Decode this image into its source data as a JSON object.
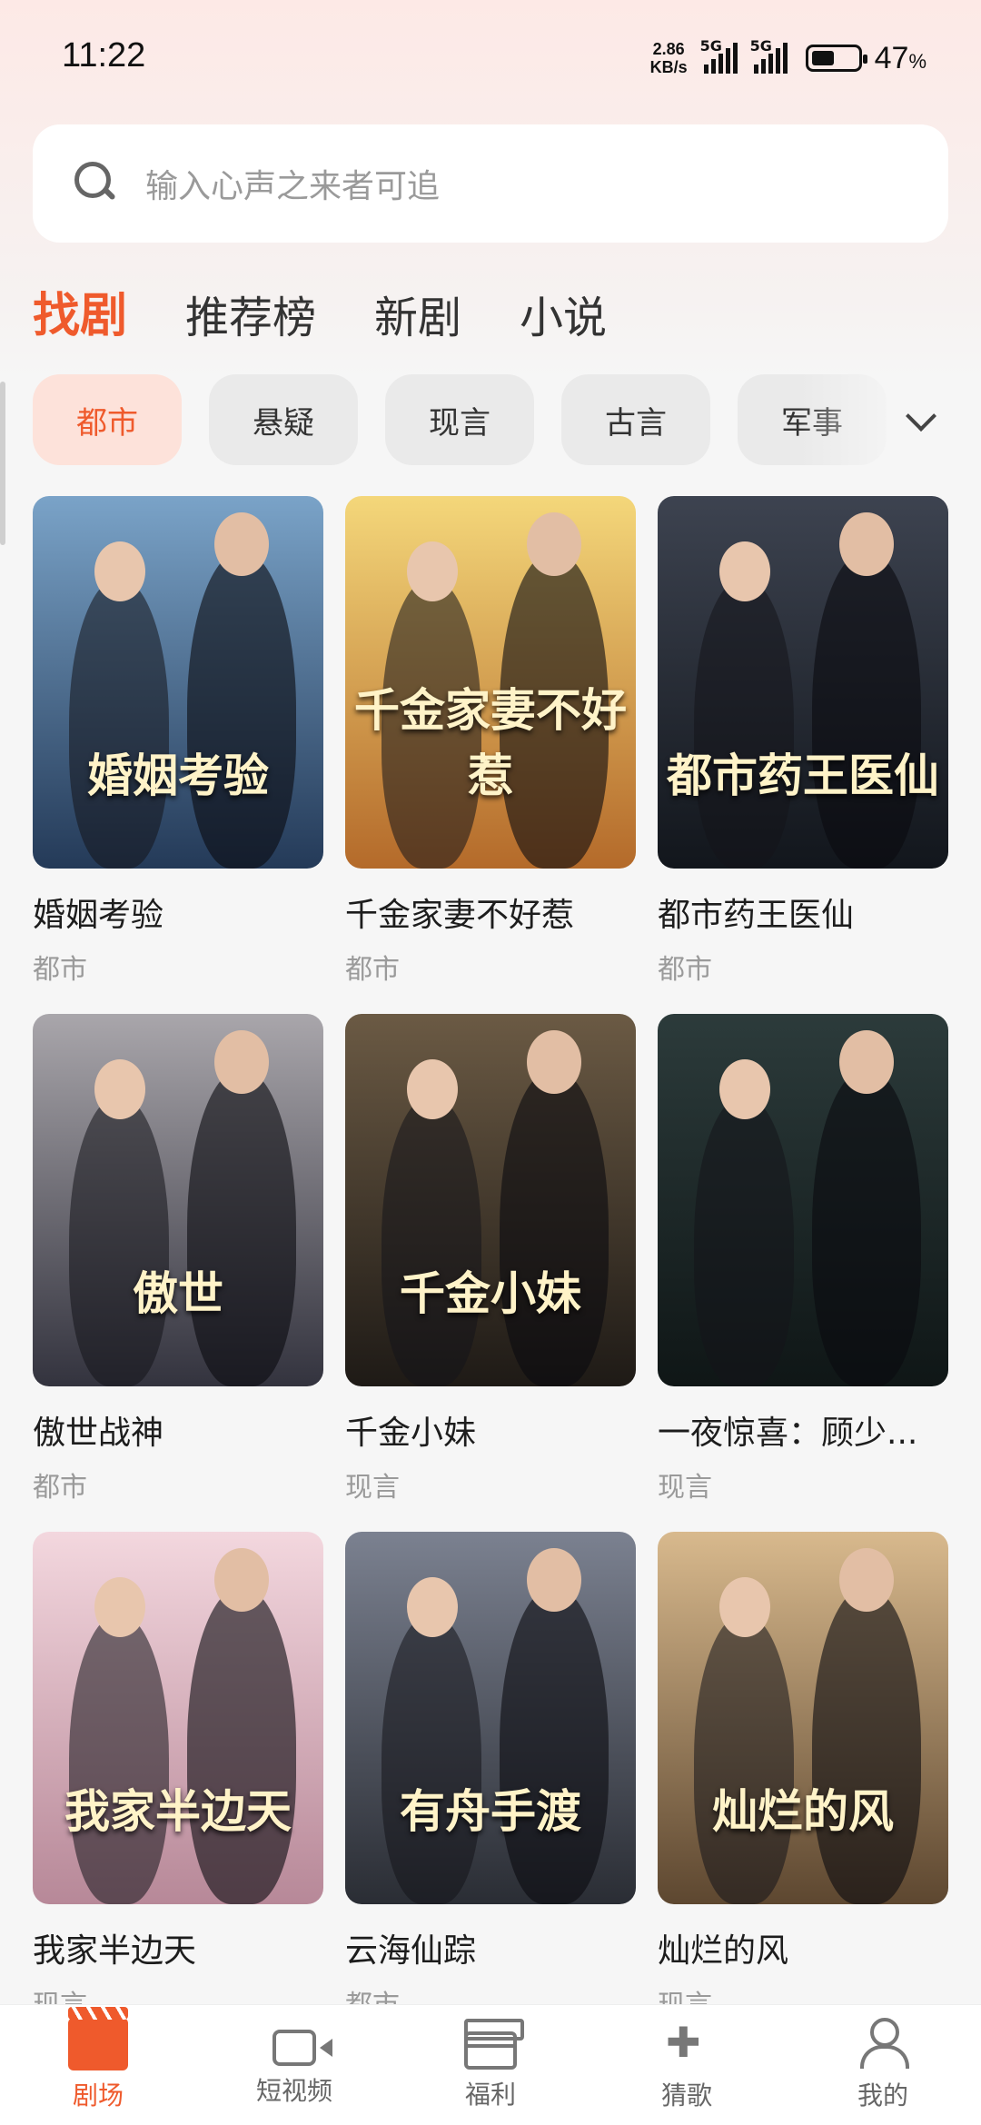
{
  "status": {
    "time": "11:22",
    "net_speed_value": "2.86",
    "net_speed_unit": "KB/s",
    "sig1": "5G",
    "sig2": "5G",
    "battery_percent": "47",
    "battery_unit": "%"
  },
  "search": {
    "placeholder": "输入心声之来者可追"
  },
  "top_tabs": [
    "找剧",
    "推荐榜",
    "新剧",
    "小说"
  ],
  "chips": [
    "都市",
    "悬疑",
    "现言",
    "古言",
    "军事"
  ],
  "items": [
    {
      "title": "婚姻考验",
      "tag": "都市",
      "poster_text": "婚姻考验",
      "colors": [
        "#7aa3c8",
        "#243a58"
      ]
    },
    {
      "title": "千金家妻不好惹",
      "tag": "都市",
      "poster_text": "千金家妻不好惹",
      "colors": [
        "#f4d77a",
        "#b46a2a"
      ]
    },
    {
      "title": "都市药王医仙",
      "tag": "都市",
      "poster_text": "都市药王医仙",
      "colors": [
        "#3d4350",
        "#12161c"
      ]
    },
    {
      "title": "傲世战神",
      "tag": "都市",
      "poster_text": "傲世",
      "colors": [
        "#a9a6ab",
        "#33333e"
      ]
    },
    {
      "title": "千金小妹",
      "tag": "现言",
      "poster_text": "千金小妹",
      "colors": [
        "#6b5a44",
        "#1e1a16"
      ]
    },
    {
      "title": "一夜惊喜：顾少...",
      "tag": "现言",
      "poster_text": "",
      "colors": [
        "#2c3b3b",
        "#0f1616"
      ]
    },
    {
      "title": "我家半边天",
      "tag": "现言",
      "poster_text": "我家半边天",
      "colors": [
        "#f3d7de",
        "#b78898"
      ]
    },
    {
      "title": "云海仙踪",
      "tag": "都市",
      "poster_text": "有舟手渡",
      "colors": [
        "#7b8190",
        "#2a2d34"
      ]
    },
    {
      "title": "灿烂的风",
      "tag": "现言",
      "poster_text": "灿烂的风",
      "colors": [
        "#d8b98d",
        "#5d4730"
      ]
    }
  ],
  "nav": [
    {
      "label": "剧场",
      "icon": "clapper-icon",
      "active": true
    },
    {
      "label": "短视频",
      "icon": "video-camera-icon",
      "active": false
    },
    {
      "label": "福利",
      "icon": "gift-icon",
      "active": false
    },
    {
      "label": "猜歌",
      "icon": "gamepad-icon",
      "active": false
    },
    {
      "label": "我的",
      "icon": "user-icon",
      "active": false
    }
  ],
  "accent_color": "#ef5a2c"
}
